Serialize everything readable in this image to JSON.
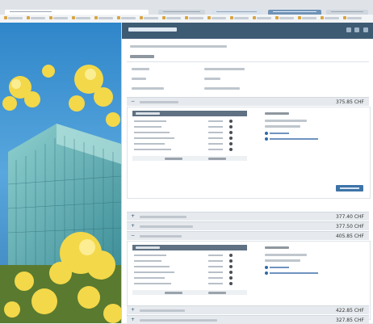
{
  "colors": {
    "panel_header": "#3e5b74",
    "product_row": "#e6eaee",
    "table_header": "#5f7183",
    "button": "#3d74a8",
    "link": "#2f6aa6"
  },
  "icons": {
    "expand": "+",
    "collapse": "−"
  },
  "panel": {
    "title": "",
    "section_title": ""
  },
  "products": [
    {
      "expanded": true,
      "price": "375.85 CHF"
    },
    {
      "expanded": false,
      "price": "377.40 CHF"
    },
    {
      "expanded": false,
      "price": "377.50 CHF"
    },
    {
      "expanded": true,
      "price": "405.85 CHF"
    },
    {
      "expanded": false,
      "price": "422.85 CHF"
    },
    {
      "expanded": false,
      "price": "327.85 CHF"
    }
  ],
  "tables": [
    {
      "total": ""
    },
    {
      "total": ""
    }
  ]
}
